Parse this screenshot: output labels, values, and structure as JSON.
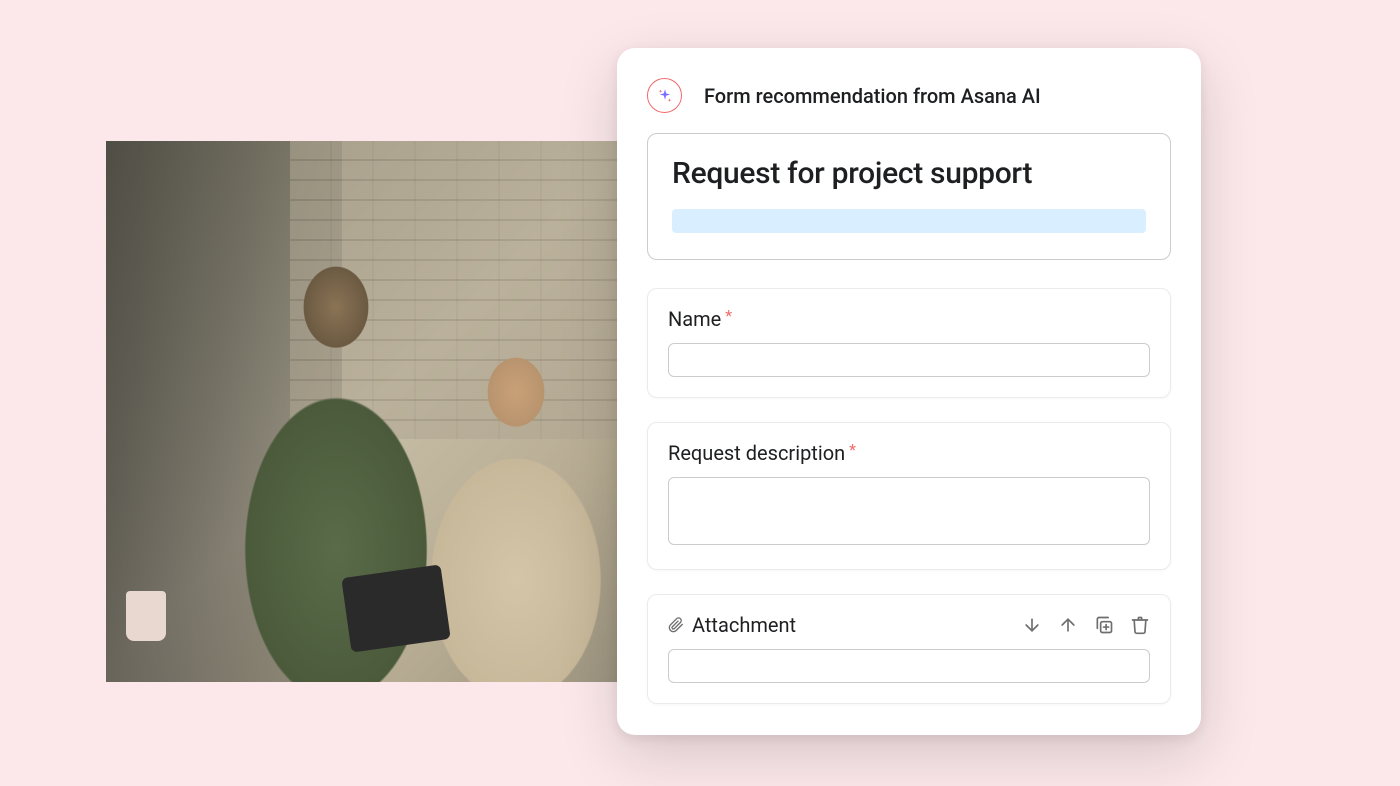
{
  "header": {
    "label": "Form recommendation from Asana AI"
  },
  "form": {
    "title": "Request for project support",
    "fields": {
      "name": {
        "label": "Name",
        "required": true
      },
      "description": {
        "label": "Request description",
        "required": true
      },
      "attachment": {
        "label": "Attachment"
      }
    }
  },
  "icons": {
    "ai": "sparkle-icon",
    "paperclip": "paperclip-icon",
    "arrow_down": "arrow-down-icon",
    "arrow_up": "arrow-up-icon",
    "duplicate": "duplicate-icon",
    "trash": "trash-icon"
  },
  "colors": {
    "bg": "#fce8eb",
    "accent": "#f06a6a",
    "highlight": "#d9efff",
    "text": "#1e1f21",
    "muted": "#6d6e6f",
    "border": "#cfcbcb"
  }
}
